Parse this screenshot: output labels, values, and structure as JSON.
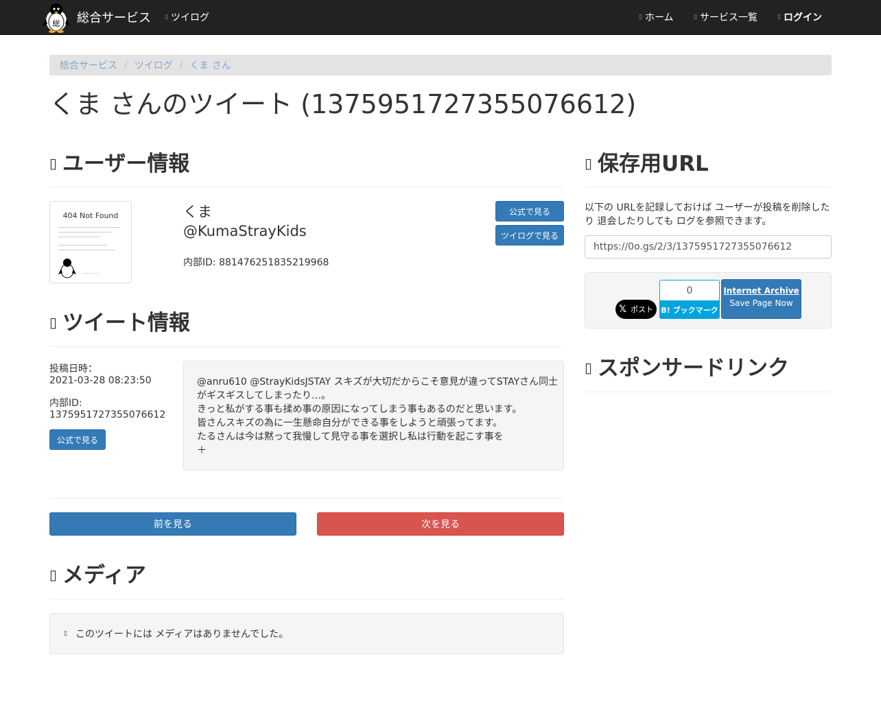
{
  "navbar": {
    "brand": "総合サービス",
    "tweilog": "ツイログ",
    "home": "ホーム",
    "services": "サービス一覧",
    "login": "ログイン"
  },
  "breadcrumb": [
    "総合サービス",
    "ツイログ",
    "くま さん"
  ],
  "page_title": "くま さんのツイート (1375951727355076612)",
  "user_section": {
    "heading": "ユーザー情報",
    "avatar_text": "404 Not Found",
    "name": "くま",
    "handle": "@KumaStrayKids",
    "internal_id": "内部ID: 881476251835219968",
    "official_button": "公式で見る",
    "tweilog_button": "ツイログで見る"
  },
  "tweet_section": {
    "heading": "ツイート情報",
    "posted_label": "投稿日時：",
    "posted_value": "2021-03-28 08:23:50",
    "id_label": "内部ID:",
    "id_value": "1375951727355076612",
    "official_button": "公式で見る",
    "lines": [
      "@anru610 @StrayKidsJSTAY スキズが大切だからこそ意見が違ってSTAYさん同士",
      "がギスギスしてしまったり…。",
      "きっと私がする事も揉め事の原因になってしまう事もあるのだと思います。",
      "皆さんスキズの為に一生懸命自分ができる事をしようと頑張ってます。",
      "たるさんは今は黙って我慢して見守る事を選択し私は行動を起こす事を",
      "＋"
    ]
  },
  "pager": {
    "prev": "前を見る",
    "next": "次を見る"
  },
  "media_section": {
    "heading": "メディア",
    "empty_message": "このツイートには メディアはありませんでした。"
  },
  "save_section": {
    "heading": "保存用URL",
    "description": "以下の URLを記録しておけば ユーザーが投稿を削除したり 退会したりしても ログを参照できます。",
    "url": "https://0o.gs/2/3/1375951727355076612"
  },
  "share": {
    "x_label": "ポスト",
    "hatena_count": "0",
    "hatena_label": "B! ブックマーク",
    "ia_title": "Internet Archive",
    "ia_sub": "Save Page Now"
  },
  "sponsor_section": {
    "heading": "スポンサードリンク"
  },
  "colors": {
    "navbar": "#222222",
    "primary": "#337ab7",
    "danger": "#d9534f",
    "hatena": "#00a4de"
  }
}
